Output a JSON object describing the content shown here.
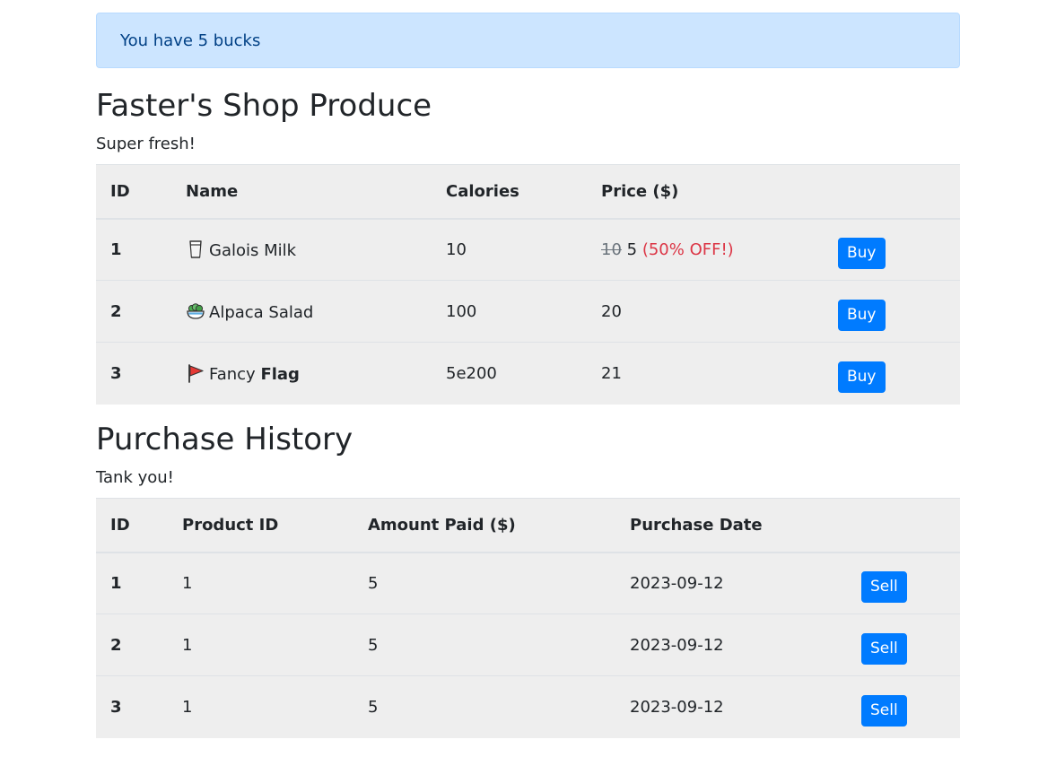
{
  "alert": {
    "text": "You have 5 bucks"
  },
  "shop": {
    "title": "Faster's Shop Produce",
    "subtitle": "Super fresh!",
    "headers": {
      "id": "ID",
      "name": "Name",
      "calories": "Calories",
      "price": "Price ($)"
    },
    "rows": [
      {
        "id": "1",
        "icon": "milk-glass-icon",
        "name": "Galois Milk",
        "name_bold": "",
        "calories": "10",
        "old_price": "10",
        "price": "5",
        "discount": "(50% OFF!)",
        "button": "Buy"
      },
      {
        "id": "2",
        "icon": "salad-bowl-icon",
        "name": "Alpaca Salad",
        "name_bold": "",
        "calories": "100",
        "old_price": "",
        "price": "20",
        "discount": "",
        "button": "Buy"
      },
      {
        "id": "3",
        "icon": "red-flag-icon",
        "name": "Fancy",
        "name_bold": "Flag",
        "calories": "5e200",
        "old_price": "",
        "price": "21",
        "discount": "",
        "button": "Buy"
      }
    ]
  },
  "history": {
    "title": "Purchase History",
    "subtitle": "Tank you!",
    "headers": {
      "id": "ID",
      "product_id": "Product ID",
      "amount": "Amount Paid ($)",
      "date": "Purchase Date"
    },
    "rows": [
      {
        "id": "1",
        "product_id": "1",
        "amount": "5",
        "date": "2023-09-12",
        "button": "Sell"
      },
      {
        "id": "2",
        "product_id": "1",
        "amount": "5",
        "date": "2023-09-12",
        "button": "Sell"
      },
      {
        "id": "3",
        "product_id": "1",
        "amount": "5",
        "date": "2023-09-12",
        "button": "Sell"
      }
    ]
  },
  "colors": {
    "alert_bg": "#cce5ff",
    "alert_text": "#004085",
    "button": "#007bff",
    "discount": "#dc3545",
    "table_bg": "#eeeeee"
  }
}
